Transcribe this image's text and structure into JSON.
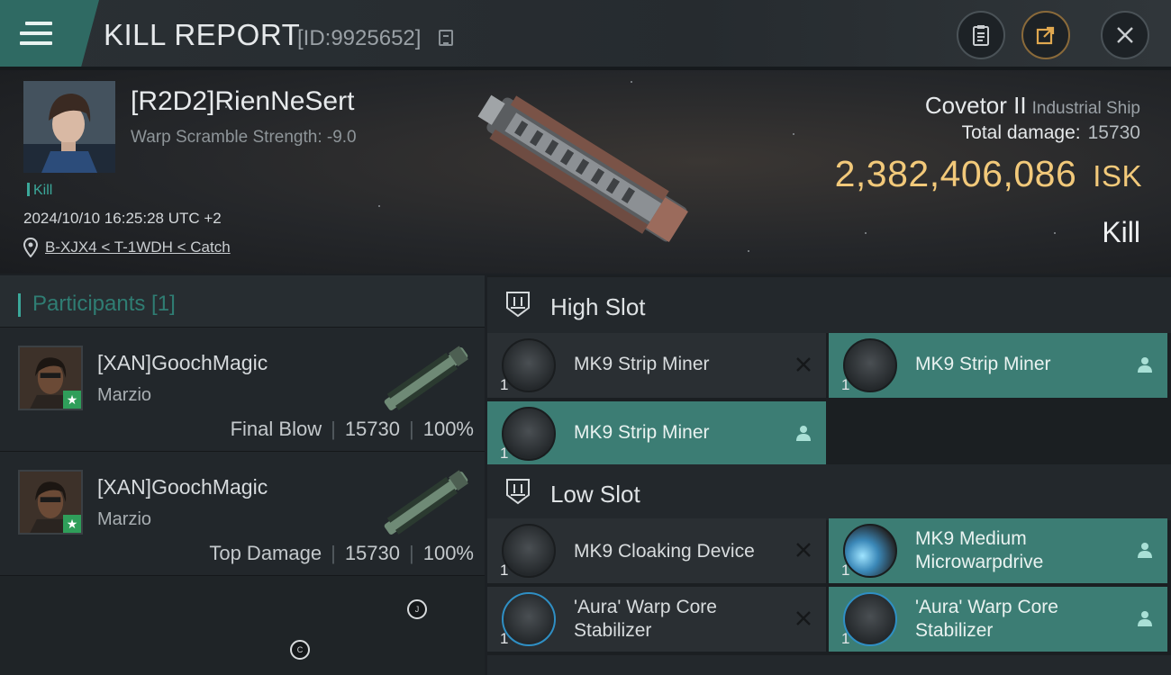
{
  "header": {
    "title": "KILL REPORT",
    "report_id": "[ID:9925652]",
    "buttons": [
      "clipboard-icon",
      "share-icon",
      "close-icon"
    ]
  },
  "victim": {
    "name": "[R2D2]RienNeSert",
    "warp_scramble": "Warp Scramble Strength: -9.0",
    "tag": "Kill",
    "timestamp": "2024/10/10 16:25:28 UTC +2",
    "location": "B-XJX4 < T-1WDH < Catch"
  },
  "ship": {
    "name": "Covetor II",
    "class": "Industrial Ship",
    "total_damage_label": "Total damage:",
    "total_damage": "15730",
    "isk_value": "2,382,406,086",
    "isk_unit": "ISK",
    "result": "Kill"
  },
  "participants": {
    "header": "Participants [1]",
    "rows": [
      {
        "name": "[XAN]GoochMagic",
        "corp": "Marzio",
        "role": "Final Blow",
        "damage": "15730",
        "percent": "100%"
      },
      {
        "name": "[XAN]GoochMagic",
        "corp": "Marzio",
        "role": "Top Damage",
        "damage": "15730",
        "percent": "100%"
      }
    ]
  },
  "fitting": {
    "high_slot": {
      "label": "High Slot",
      "items": [
        {
          "qty": "1",
          "name": "MK9 Strip Miner",
          "state": "destroyed"
        },
        {
          "qty": "1",
          "name": "MK9 Strip Miner",
          "state": "dropped"
        },
        {
          "qty": "1",
          "name": "MK9 Strip Miner",
          "state": "dropped"
        }
      ]
    },
    "low_slot": {
      "label": "Low Slot",
      "items": [
        {
          "qty": "1",
          "name": "MK9 Cloaking Device",
          "state": "destroyed"
        },
        {
          "qty": "1",
          "name": "MK9 Medium Microwarpdrive",
          "state": "dropped"
        },
        {
          "qty": "1",
          "name": "'Aura' Warp Core Stabilizer",
          "state": "destroyed"
        },
        {
          "qty": "1",
          "name": "'Aura' Warp Core Stabilizer",
          "state": "dropped"
        }
      ]
    }
  },
  "colors": {
    "accent_teal": "#3ba89a",
    "dropped_bg": "#3c7d74",
    "isk_gold": "#f2c97a"
  }
}
